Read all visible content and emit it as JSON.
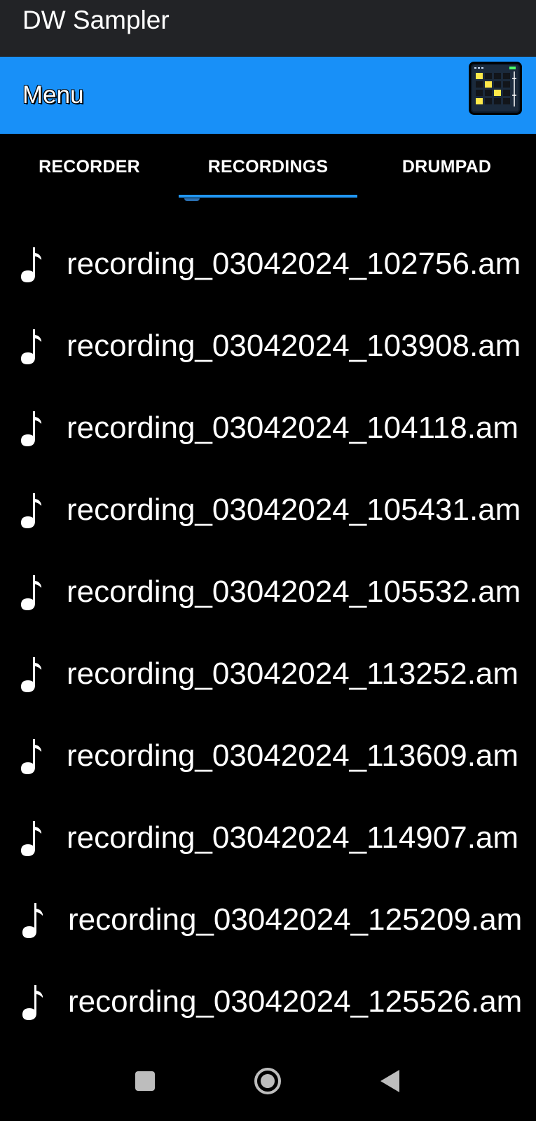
{
  "app": {
    "title": "DW Sampler"
  },
  "menu_bar": {
    "title": "Menu",
    "icon": "drumpad-grid-icon"
  },
  "tabs": [
    {
      "label": "RECORDER",
      "selected": false
    },
    {
      "label": "RECORDINGS",
      "selected": true
    },
    {
      "label": "DRUMPAD",
      "selected": false
    }
  ],
  "recordings": [
    {
      "name": "recording_03042024_102756.am",
      "icon": "music-note-icon"
    },
    {
      "name": "recording_03042024_103908.am",
      "icon": "music-note-icon"
    },
    {
      "name": "recording_03042024_104118.am",
      "icon": "music-note-icon"
    },
    {
      "name": "recording_03042024_105431.am",
      "icon": "music-note-icon"
    },
    {
      "name": "recording_03042024_105532.am",
      "icon": "music-note-icon"
    },
    {
      "name": "recording_03042024_113252.am",
      "icon": "music-note-icon"
    },
    {
      "name": "recording_03042024_113609.am",
      "icon": "music-note-icon"
    },
    {
      "name": "recording_03042024_114907.am",
      "icon": "music-note-icon"
    },
    {
      "name": "recording_03042024_125209.am",
      "icon": "music-note-icon"
    },
    {
      "name": "recording_03042024_125526.am",
      "icon": "music-note-icon"
    }
  ],
  "nav": {
    "recents": "recents-square-icon",
    "home": "home-circle-icon",
    "back": "back-triangle-icon"
  },
  "colors": {
    "title_bar": "#222326",
    "menu_bar": "#1890f8",
    "tab_indicator": "#2196f3",
    "background": "#000000",
    "text": "#ffffff"
  }
}
